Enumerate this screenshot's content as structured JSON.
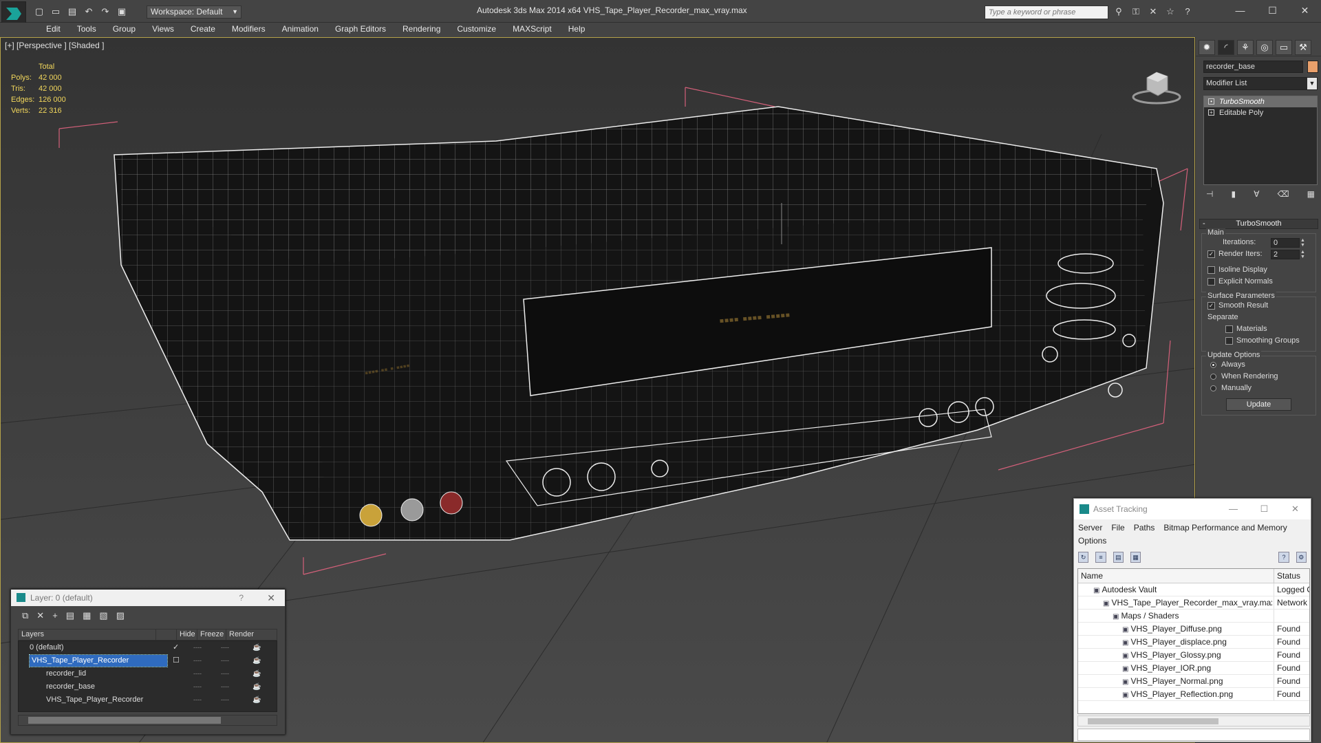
{
  "titlebar": {
    "workspace_label": "Workspace: Default",
    "title": "Autodesk 3ds Max  2014 x64      VHS_Tape_Player_Recorder_max_vray.max",
    "search_placeholder": "Type a keyword or phrase",
    "quick_access_icons": [
      "new-icon",
      "open-icon",
      "save-icon",
      "undo-icon",
      "redo-icon",
      "project-icon"
    ],
    "search_tool_icons": [
      "binoculars-icon",
      "key-icon",
      "exchange-icon",
      "star-icon",
      "help-icon"
    ],
    "window_controls": [
      "minimize",
      "maximize",
      "close"
    ]
  },
  "menu": [
    "Edit",
    "Tools",
    "Group",
    "Views",
    "Create",
    "Modifiers",
    "Animation",
    "Graph Editors",
    "Rendering",
    "Customize",
    "MAXScript",
    "Help"
  ],
  "viewport": {
    "label": "[+] [Perspective ] [Shaded ]",
    "stats_header": "Total",
    "stats": [
      {
        "k": "Polys:",
        "v": "42 000"
      },
      {
        "k": "Tris:",
        "v": "42 000"
      },
      {
        "k": "Edges:",
        "v": "126 000"
      },
      {
        "k": "Verts:",
        "v": "22 316"
      }
    ]
  },
  "command_panel": {
    "tab_icons": [
      "create-icon",
      "modify-icon",
      "hierarchy-icon",
      "motion-icon",
      "display-icon",
      "utilities-icon"
    ],
    "object_name": "recorder_base",
    "object_color": "#e9a06b",
    "modifier_list_label": "Modifier List",
    "stack": [
      "TurboSmooth",
      "Editable Poly"
    ],
    "rollout_title": "TurboSmooth",
    "main_group": "Main",
    "iterations_label": "Iterations:",
    "iterations_value": "0",
    "render_iters_label": "Render Iters:",
    "render_iters_value": "2",
    "isoline_label": "Isoline Display",
    "explicit_normals_label": "Explicit Normals",
    "surface_group": "Surface Parameters",
    "smooth_result_label": "Smooth Result",
    "separate_label": "Separate",
    "materials_label": "Materials",
    "smoothing_groups_label": "Smoothing Groups",
    "update_group": "Update Options",
    "always_label": "Always",
    "when_rendering_label": "When Rendering",
    "manually_label": "Manually",
    "update_button": "Update"
  },
  "layer_window": {
    "title": "Layer: 0 (default)",
    "help": "?",
    "columns": [
      "Layers",
      "Hide",
      "Freeze",
      "Render"
    ],
    "rows": [
      {
        "name": "0 (default)",
        "indent": 16,
        "selected": false,
        "check": "✓"
      },
      {
        "name": "VHS_Tape_Player_Recorder",
        "indent": 16,
        "selected": true,
        "check": "☐"
      },
      {
        "name": "recorder_lid",
        "indent": 28,
        "selected": false,
        "check": ""
      },
      {
        "name": "recorder_base",
        "indent": 28,
        "selected": false,
        "check": ""
      },
      {
        "name": "VHS_Tape_Player_Recorder",
        "indent": 28,
        "selected": false,
        "check": ""
      }
    ],
    "hide_placeholder": "----",
    "freeze_placeholder": "----"
  },
  "asset_window": {
    "title": "Asset Tracking",
    "menu": [
      "Server",
      "File",
      "Paths",
      "Bitmap Performance and Memory"
    ],
    "menu_row2": "Options",
    "col_name": "Name",
    "col_status": "Status",
    "rows": [
      {
        "name": "Autodesk Vault",
        "indent": 22,
        "status": "Logged O"
      },
      {
        "name": "VHS_Tape_Player_Recorder_max_vray.max",
        "indent": 36,
        "status": "Network P"
      },
      {
        "name": "Maps / Shaders",
        "indent": 50,
        "status": ""
      },
      {
        "name": "VHS_Player_Diffuse.png",
        "indent": 64,
        "status": "Found"
      },
      {
        "name": "VHS_Player_displace.png",
        "indent": 64,
        "status": "Found"
      },
      {
        "name": "VHS_Player_Glossy.png",
        "indent": 64,
        "status": "Found"
      },
      {
        "name": "VHS_Player_IOR.png",
        "indent": 64,
        "status": "Found"
      },
      {
        "name": "VHS_Player_Normal.png",
        "indent": 64,
        "status": "Found"
      },
      {
        "name": "VHS_Player_Reflection.png",
        "indent": 64,
        "status": "Found"
      }
    ]
  }
}
